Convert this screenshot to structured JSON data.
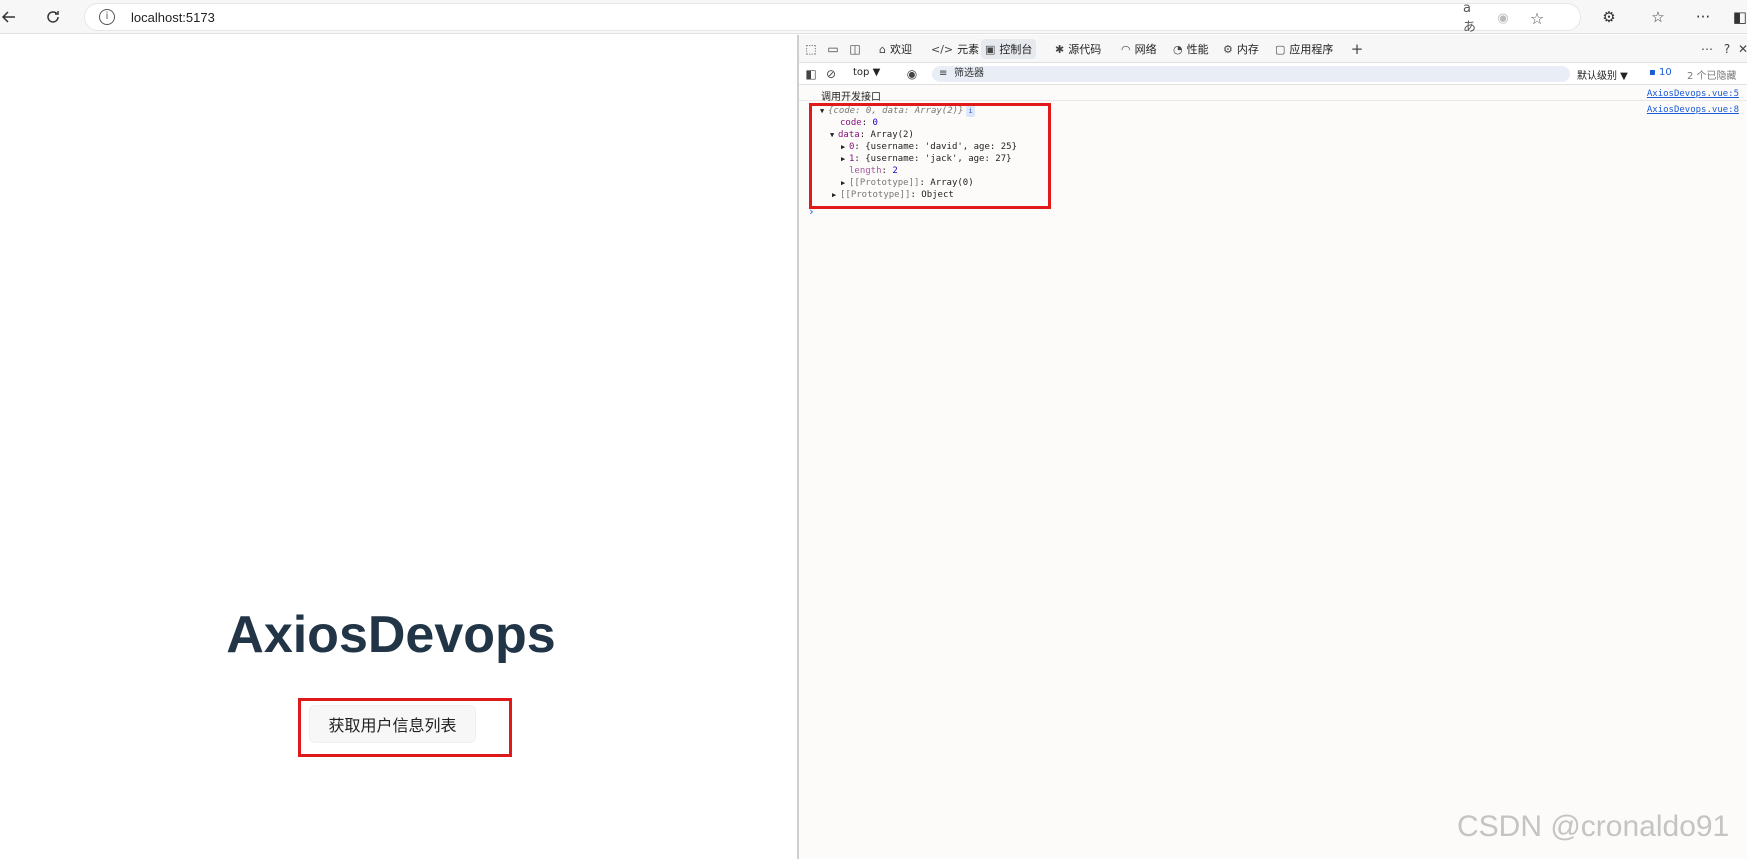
{
  "browser": {
    "url": "localhost:5173",
    "icons": [
      "back-icon",
      "refresh-icon",
      "info-icon",
      "read-aloud-icon",
      "tracking-icon",
      "favorite-star-icon",
      "extensions-icon",
      "favorites-icon",
      "more-icon",
      "sidebar-icon"
    ],
    "read_aloud_glyph": "aあ",
    "more_glyph": "···"
  },
  "page": {
    "title": "AxiosDevops",
    "fetch_button": "获取用户信息列表"
  },
  "devtools": {
    "tabs": [
      {
        "label": "欢迎",
        "icon": "home-icon"
      },
      {
        "label": "元素",
        "icon": "code-icon"
      },
      {
        "label": "控制台",
        "icon": "console-icon",
        "active": true
      },
      {
        "label": "源代码",
        "icon": "bug-icon"
      },
      {
        "label": "网络",
        "icon": "wifi-icon"
      },
      {
        "label": "性能",
        "icon": "performance-icon"
      },
      {
        "label": "内存",
        "icon": "memory-icon"
      },
      {
        "label": "应用程序",
        "icon": "application-icon"
      }
    ],
    "toolbar": {
      "context": "top",
      "filter_placeholder": "筛选器",
      "level": "默认级别",
      "issues_count": "10",
      "hidden_count": "2 个已隐藏"
    },
    "console": {
      "log_message": "调用开发接口",
      "log_source": "AxiosDevops.vue:5",
      "obj_source": "AxiosDevops.vue:8",
      "object_summary": "{code: 0, data: Array(2)}",
      "info_badge": "i",
      "code_key": "code",
      "code_value": "0",
      "data_key": "data",
      "data_value": "Array(2)",
      "item0_key": "0",
      "item0_value": "{username: 'david', age: 25}",
      "item1_key": "1",
      "item1_value": "{username: 'jack', age: 27}",
      "length_key": "length",
      "length_value": "2",
      "proto_key": "[[Prototype]]",
      "array_proto_value": "Array(0)",
      "object_proto_value": "Object",
      "prompt": "›"
    }
  },
  "watermark": "CSDN @cronaldo91",
  "colors": {
    "highlight_box": "#e01a1a",
    "title": "#213547",
    "link": "#1a5bd6"
  }
}
